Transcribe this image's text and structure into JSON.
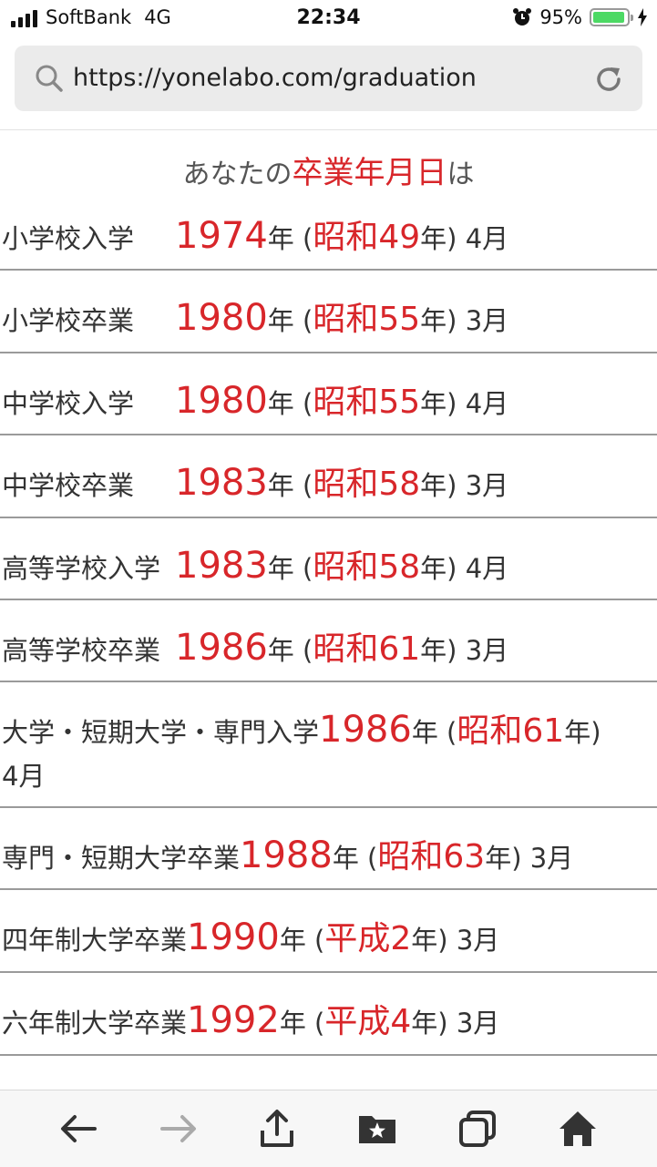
{
  "status": {
    "carrier": "SoftBank",
    "network": "4G",
    "time": "22:34",
    "battery_pct": "95%",
    "battery_level": 0.95
  },
  "browser": {
    "url": "https://yonelabo.com/graduation"
  },
  "headline": {
    "prefix": "あなたの",
    "highlight": "卒業年月日",
    "suffix": "は"
  },
  "rows": [
    {
      "label": "小学校入学",
      "year": "1974",
      "era": "昭和49",
      "month": "4月"
    },
    {
      "label": "小学校卒業",
      "year": "1980",
      "era": "昭和55",
      "month": "3月"
    },
    {
      "label": "中学校入学",
      "year": "1980",
      "era": "昭和55",
      "month": "4月"
    },
    {
      "label": "中学校卒業",
      "year": "1983",
      "era": "昭和58",
      "month": "3月"
    },
    {
      "label": "高等学校入学",
      "year": "1983",
      "era": "昭和58",
      "month": "4月"
    },
    {
      "label": "高等学校卒業",
      "year": "1986",
      "era": "昭和61",
      "month": "3月"
    },
    {
      "label": "大学・短期大学・専門入学",
      "year": "1986",
      "era": "昭和61",
      "month": "4月"
    },
    {
      "label": "専門・短期大学卒業",
      "year": "1988",
      "era": "昭和63",
      "month": "3月"
    },
    {
      "label": "四年制大学卒業",
      "year": "1990",
      "era": "平成2",
      "month": "3月"
    },
    {
      "label": "六年制大学卒業",
      "year": "1992",
      "era": "平成4",
      "month": "3月"
    }
  ],
  "units": {
    "year_suffix": "年",
    "open_paren": "(",
    "close": "年)"
  },
  "colors": {
    "accent_red": "#d8262a",
    "battery_green": "#4cd964",
    "text": "#333333"
  },
  "toolbar": {
    "icons": [
      "back-arrow-icon",
      "forward-arrow-icon",
      "share-icon",
      "bookmarks-icon",
      "tabs-icon",
      "home-icon"
    ]
  }
}
